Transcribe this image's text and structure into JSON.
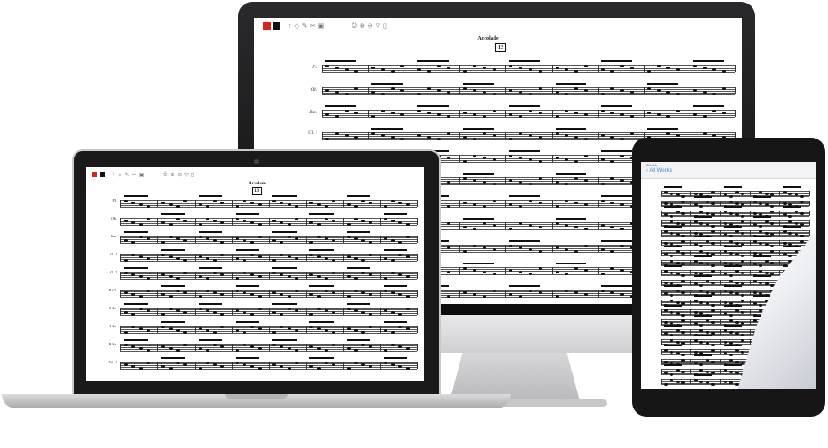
{
  "monitor": {
    "toolbar": {
      "stop_icon": "square-red",
      "record_icon": "square-black",
      "print_icon": "printer",
      "zoom_in_icon": "zoom-in",
      "zoom_out_icon": "zoom-out",
      "filter_icon": "funnel",
      "page_icon": "page"
    },
    "score": {
      "title": "Accolade",
      "measure_number": "13",
      "instruments": [
        "Fl.",
        "Ob.",
        "Bsn.",
        "Cl. 1"
      ]
    }
  },
  "laptop": {
    "score": {
      "title": "Accolade",
      "measure_number": "13",
      "instruments": [
        "Fl.",
        "Ob.",
        "Bsn.",
        "Cl. 1",
        "Cl. 2",
        "B. Cl.",
        "A. Sx.",
        "T. Sx.",
        "B. Sx.",
        "Tpt. 1"
      ]
    }
  },
  "tablet": {
    "status": "iPad ✈",
    "back_label": "All Works"
  },
  "colors": {
    "stop": "#d9231f",
    "back_link": "#3b8cd6",
    "bezel": "#161617"
  }
}
